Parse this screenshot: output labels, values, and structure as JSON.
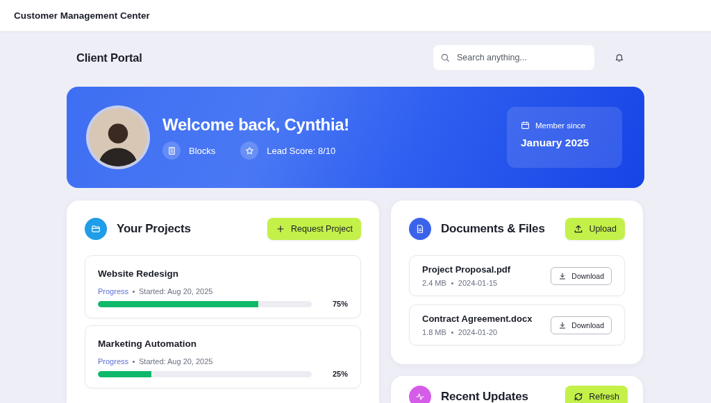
{
  "app_title": "Customer Management Center",
  "header": {
    "title": "Client Portal",
    "search": {
      "placeholder": "Search anything..."
    }
  },
  "hero": {
    "greeting": "Welcome back, Cynthia!",
    "company": "Blocks",
    "lead_score": "Lead Score: 8/10",
    "member_label": "Member since",
    "member_date": "January 2025"
  },
  "projects": {
    "title": "Your Projects",
    "action": "Request Project",
    "items": [
      {
        "name": "Website Redesign",
        "status": "Progress",
        "started": "Started: Aug 20, 2025",
        "level": 0.75,
        "percent": "75%"
      },
      {
        "name": "Marketing Automation",
        "status": "Progress",
        "started": "Started: Aug 20, 2025",
        "level": 0.25,
        "percent": "25%"
      }
    ]
  },
  "documents": {
    "title": "Documents & Files",
    "action": "Upload",
    "files": [
      {
        "name": "Project Proposal.pdf",
        "size": "2.4 MB",
        "date": "2024-01-15",
        "action": "Download"
      },
      {
        "name": "Contract Agreement.docx",
        "size": "1.8 MB",
        "date": "2024-01-20",
        "action": "Download"
      }
    ]
  },
  "updates": {
    "title": "Recent Updates",
    "action": "Refresh"
  }
}
